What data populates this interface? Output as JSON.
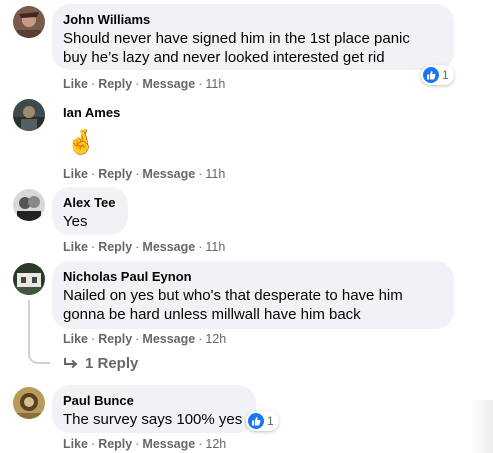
{
  "comments": [
    {
      "author": "John Williams",
      "text_lines": [
        "Should never have signed him in the 1st place panic",
        "buy he’s lazy and never looked interested get rid"
      ],
      "actions": {
        "like": "Like",
        "reply": "Reply",
        "message": "Message",
        "time": "11h"
      },
      "reaction_count": "1"
    },
    {
      "author": "Ian Ames",
      "emoji": "🤞",
      "actions": {
        "like": "Like",
        "reply": "Reply",
        "message": "Message",
        "time": "11h"
      }
    },
    {
      "author": "Alex Tee",
      "text_lines": [
        "Yes"
      ],
      "actions": {
        "like": "Like",
        "reply": "Reply",
        "message": "Message",
        "time": "11h"
      }
    },
    {
      "author": "Nicholas Paul Eynon",
      "text_lines": [
        "Nailed on yes but who's that desperate to have him",
        "gonna be hard unless millwall have him back"
      ],
      "actions": {
        "like": "Like",
        "reply": "Reply",
        "message": "Message",
        "time": "12h"
      },
      "replies_label": "1 Reply"
    },
    {
      "author": "Paul Bunce",
      "text_lines": [
        "The survey says 100% yes"
      ],
      "actions": {
        "like": "Like",
        "reply": "Reply",
        "message": "Message",
        "time": "12h"
      },
      "reaction_count": "1"
    }
  ],
  "separator": "·",
  "colors": {
    "bubble": "#f0f2f5",
    "meta": "#65676b",
    "like_blue": "#1877f2"
  }
}
